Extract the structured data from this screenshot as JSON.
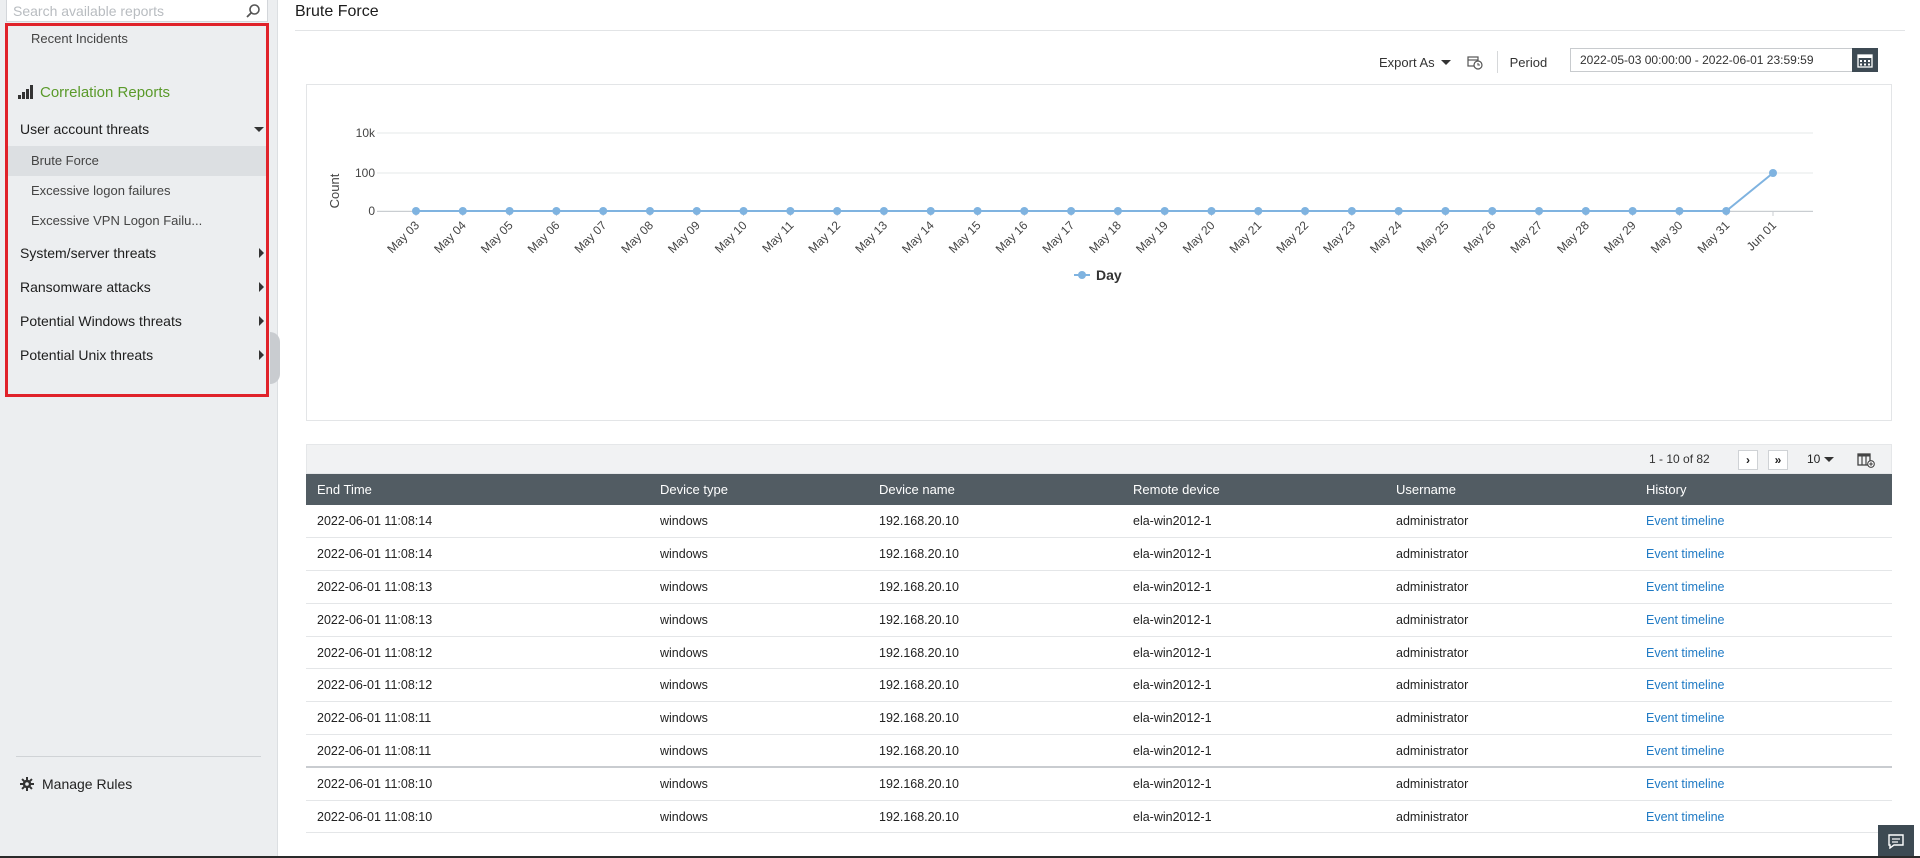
{
  "sidebar": {
    "search_placeholder": "Search available reports",
    "recent_incidents": "Recent Incidents",
    "section_title": "Correlation Reports",
    "groups": [
      {
        "label": "User account threats",
        "expanded": true,
        "items": [
          "Brute Force",
          "Excessive logon failures",
          "Excessive VPN Logon Failu..."
        ]
      },
      {
        "label": "System/server threats",
        "expanded": false
      },
      {
        "label": "Ransomware attacks",
        "expanded": false
      },
      {
        "label": "Potential Windows threats",
        "expanded": false
      },
      {
        "label": "Potential Unix threats",
        "expanded": false
      }
    ],
    "active_item": "Brute Force",
    "manage_rules": "Manage Rules",
    "highlight_color": "#e0222a",
    "accent_color": "#5a9a2a"
  },
  "header": {
    "title": "Brute Force"
  },
  "toolbar": {
    "export_label": "Export As",
    "schedule_icon": "schedule-icon",
    "period_label": "Period",
    "period_value": "2022-05-03 00:00:00 - 2022-06-01 23:59:59"
  },
  "chart_data": {
    "type": "line",
    "x": [
      "May 03",
      "May 04",
      "May 05",
      "May 06",
      "May 07",
      "May 08",
      "May 09",
      "May 10",
      "May 11",
      "May 12",
      "May 13",
      "May 14",
      "May 15",
      "May 16",
      "May 17",
      "May 18",
      "May 19",
      "May 20",
      "May 21",
      "May 22",
      "May 23",
      "May 24",
      "May 25",
      "May 26",
      "May 27",
      "May 28",
      "May 29",
      "May 30",
      "May 31",
      "Jun 01"
    ],
    "series": [
      {
        "name": "Day",
        "color": "#7fb3e0",
        "values": [
          0,
          0,
          0,
          0,
          0,
          0,
          0,
          0,
          0,
          0,
          0,
          0,
          0,
          0,
          0,
          0,
          0,
          0,
          0,
          0,
          0,
          0,
          0,
          0,
          0,
          0,
          0,
          0,
          0,
          100
        ]
      }
    ],
    "ylabel": "Count",
    "yticks": [
      "0",
      "100",
      "10k"
    ],
    "yscale": "log",
    "legend_position": "bottom-center",
    "grid": true
  },
  "pager": {
    "info": "1 - 10 of 82",
    "next": "›",
    "last": "»",
    "page_size": "10"
  },
  "table": {
    "columns": [
      "End Time",
      "Device type",
      "Device name",
      "Remote device",
      "Username",
      "History"
    ],
    "rows": [
      [
        "2022-06-01 11:08:14",
        "windows",
        "192.168.20.10",
        "ela-win2012-1",
        "administrator",
        "Event timeline"
      ],
      [
        "2022-06-01 11:08:14",
        "windows",
        "192.168.20.10",
        "ela-win2012-1",
        "administrator",
        "Event timeline"
      ],
      [
        "2022-06-01 11:08:13",
        "windows",
        "192.168.20.10",
        "ela-win2012-1",
        "administrator",
        "Event timeline"
      ],
      [
        "2022-06-01 11:08:13",
        "windows",
        "192.168.20.10",
        "ela-win2012-1",
        "administrator",
        "Event timeline"
      ],
      [
        "2022-06-01 11:08:12",
        "windows",
        "192.168.20.10",
        "ela-win2012-1",
        "administrator",
        "Event timeline"
      ],
      [
        "2022-06-01 11:08:12",
        "windows",
        "192.168.20.10",
        "ela-win2012-1",
        "administrator",
        "Event timeline"
      ],
      [
        "2022-06-01 11:08:11",
        "windows",
        "192.168.20.10",
        "ela-win2012-1",
        "administrator",
        "Event timeline"
      ],
      [
        "2022-06-01 11:08:11",
        "windows",
        "192.168.20.10",
        "ela-win2012-1",
        "administrator",
        "Event timeline"
      ],
      [
        "2022-06-01 11:08:10",
        "windows",
        "192.168.20.10",
        "ela-win2012-1",
        "administrator",
        "Event timeline"
      ],
      [
        "2022-06-01 11:08:10",
        "windows",
        "192.168.20.10",
        "ela-win2012-1",
        "administrator",
        "Event timeline"
      ]
    ]
  }
}
